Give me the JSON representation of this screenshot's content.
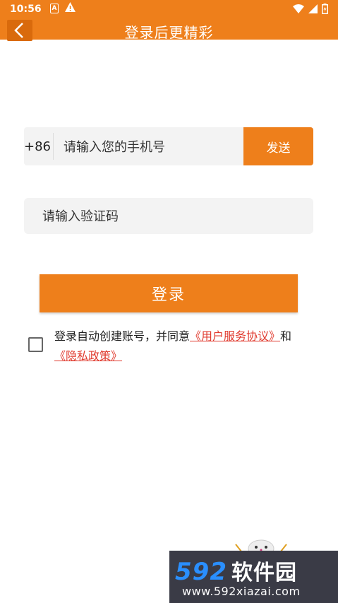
{
  "status_bar": {
    "time": "10:56",
    "icon_a": "A",
    "warning_icon": "warning-icon",
    "right_icons": [
      "wifi-icon",
      "signal-icon",
      "battery-icon"
    ]
  },
  "header": {
    "back_icon": "back-arrow-icon",
    "title": "登录后更精彩",
    "background": "#ee7f1b"
  },
  "form": {
    "country_code": "+86",
    "phone_placeholder": "请输入您的手机号",
    "phone_value": "",
    "send_label": "发送",
    "code_placeholder": "请输入验证码",
    "code_value": "",
    "login_label": "登录"
  },
  "agreement": {
    "checked": false,
    "prefix": "登录自动创建账号，并同意",
    "terms_link": "《用户服务协议》",
    "conjunction": "和",
    "privacy_link": "《隐私政策》"
  },
  "watermark": {
    "logo_number": "592",
    "logo_text": "软件园",
    "url": "www.592xiazai.com"
  },
  "colors": {
    "accent": "#ee7f1b",
    "link": "#e03a2e",
    "input_bg": "#f3f3f3"
  }
}
